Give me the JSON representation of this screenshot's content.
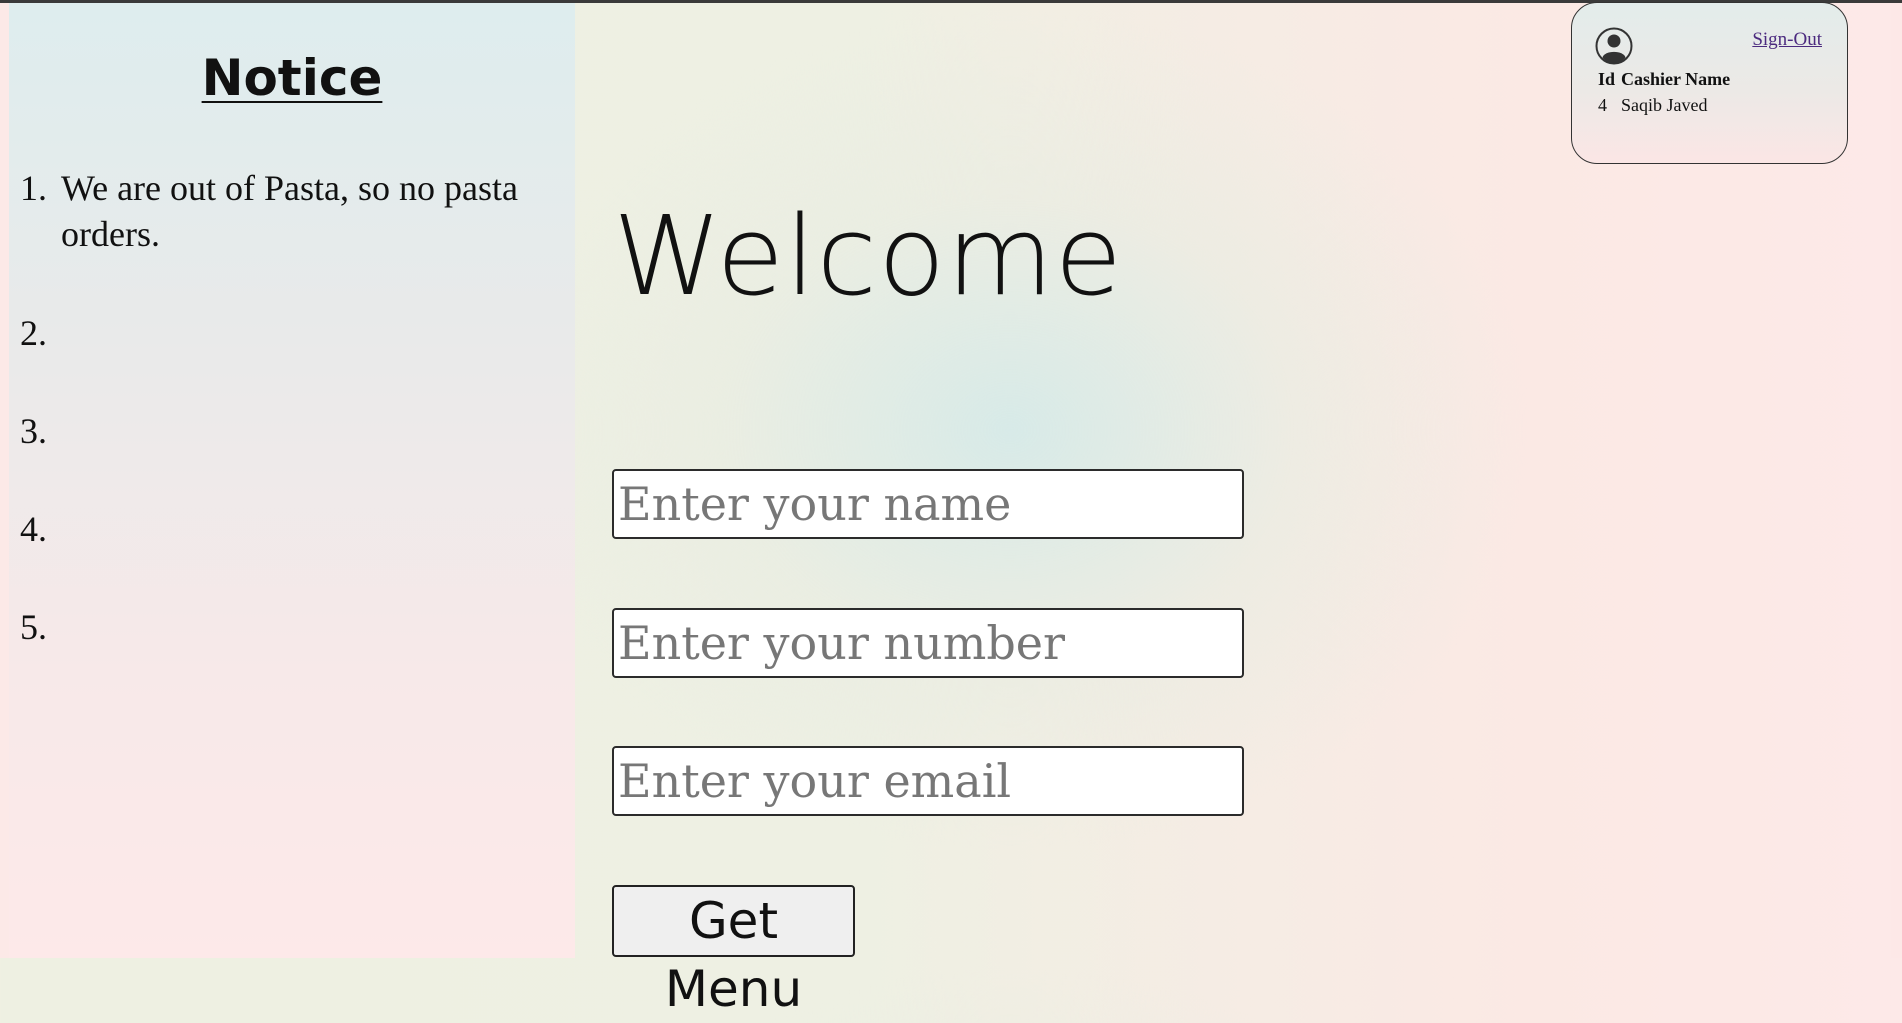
{
  "notice": {
    "title": "Notice",
    "items": [
      {
        "number": "1.",
        "text": "We are out of Pasta, so no pasta orders."
      },
      {
        "number": "2.",
        "text": ""
      },
      {
        "number": "3.",
        "text": ""
      },
      {
        "number": "4.",
        "text": ""
      },
      {
        "number": "5.",
        "text": ""
      }
    ]
  },
  "main": {
    "welcome": "Welcome",
    "name_placeholder": "Enter your name",
    "number_placeholder": "Enter your number",
    "email_placeholder": "Enter your email",
    "submit_label": "Get Menu"
  },
  "cashier": {
    "signout_label": "Sign-Out",
    "headers": [
      "Id",
      "Cashier Name"
    ],
    "id": "4",
    "name": "Saqib Javed",
    "avatar_icon": "user-circle-icon"
  },
  "colors": {
    "link": "#4b2a7f",
    "text": "#111111",
    "placeholder": "#777777"
  }
}
